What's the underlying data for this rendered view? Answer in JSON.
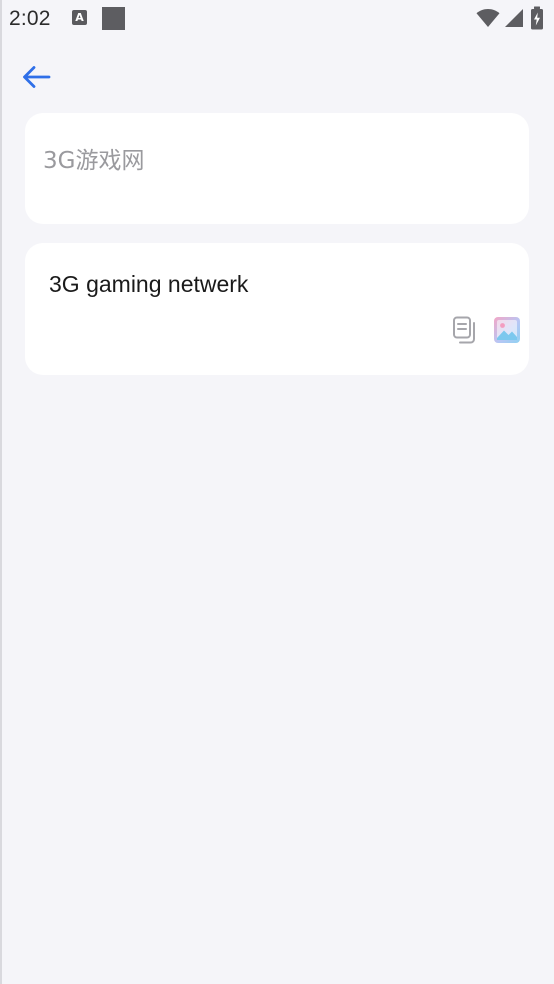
{
  "status_bar": {
    "time": "2:02",
    "notification_icon_letter": "A",
    "icons": [
      "a-notification-icon",
      "square-notification-icon",
      "wifi-icon",
      "cellular-signal-icon",
      "battery-icon"
    ]
  },
  "header": {
    "back_icon": "arrow-left-icon",
    "accent_color": "#2f6fe8"
  },
  "source_card": {
    "text": "3G游戏网"
  },
  "result_card": {
    "text": "3G gaming netwerk",
    "actions": [
      "copy-icon",
      "image-icon"
    ]
  },
  "colors": {
    "background": "#f5f5f9",
    "card": "#ffffff",
    "source_text": "#9a9a9e",
    "result_text": "#1a1a1a"
  }
}
